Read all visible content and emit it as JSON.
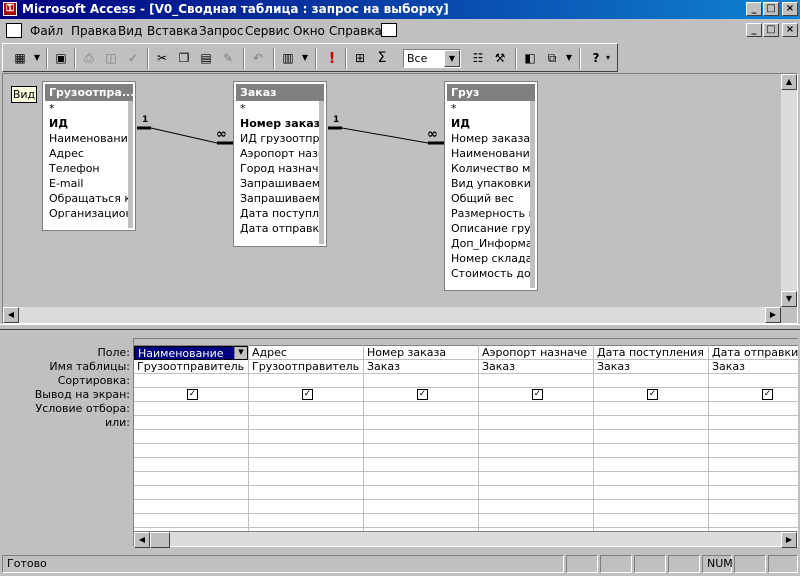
{
  "window": {
    "title": "Microsoft Access - [V0_Сводная таблица : запрос на выборку]",
    "min": "_",
    "max": "□",
    "close": "×"
  },
  "menu": [
    "Файл",
    "Правка",
    "Вид",
    "Вставка",
    "Запрос",
    "Сервис",
    "Окно",
    "Справка"
  ],
  "toolbar": {
    "top_values": "Все",
    "sigma": "Σ",
    "bang": "!"
  },
  "tooltip": "Вид",
  "tables": [
    {
      "title": "Грузоотпра...",
      "fields": [
        "*",
        "ИД",
        "Наименование",
        "Адрес",
        "Телефон",
        "E-mail",
        "Обращаться к",
        "Организационна"
      ],
      "bold": [
        1
      ]
    },
    {
      "title": "Заказ",
      "fields": [
        "*",
        "Номер заказа",
        "ИД грузоотправ",
        "Аэропорт назнач",
        "Город назначени",
        "Запрашиваемый",
        "Запрашиваемый",
        "Дата поступлен",
        "Дата отправки"
      ],
      "bold": [
        1
      ]
    },
    {
      "title": "Груз",
      "fields": [
        "*",
        "ИД",
        "Номер заказа",
        "Наименование гр",
        "Количество мест",
        "Вид упаковки",
        "Общий вес",
        "Размерность вес",
        "Описание груза",
        "Доп_Информаци",
        "Номер склада",
        "Стоимость доста"
      ],
      "bold": [
        1
      ]
    }
  ],
  "relations": {
    "one": "1",
    "many": "∞"
  },
  "grid": {
    "row_labels": [
      "Поле:",
      "Имя таблицы:",
      "Сортировка:",
      "Вывод на экран:",
      "Условие отбора:",
      "или:"
    ],
    "columns": [
      {
        "field": "Наименование",
        "table": "Грузоотправитель",
        "show": true
      },
      {
        "field": "Адрес",
        "table": "Грузоотправитель",
        "show": true
      },
      {
        "field": "Номер заказа",
        "table": "Заказ",
        "show": true
      },
      {
        "field": "Аэропорт назначе",
        "table": "Заказ",
        "show": true
      },
      {
        "field": "Дата поступления",
        "table": "Заказ",
        "show": true
      },
      {
        "field": "Дата отправки",
        "table": "Заказ",
        "show": true
      }
    ],
    "check_mark": "✓"
  },
  "status": {
    "text": "Готово",
    "num": "NUM"
  }
}
